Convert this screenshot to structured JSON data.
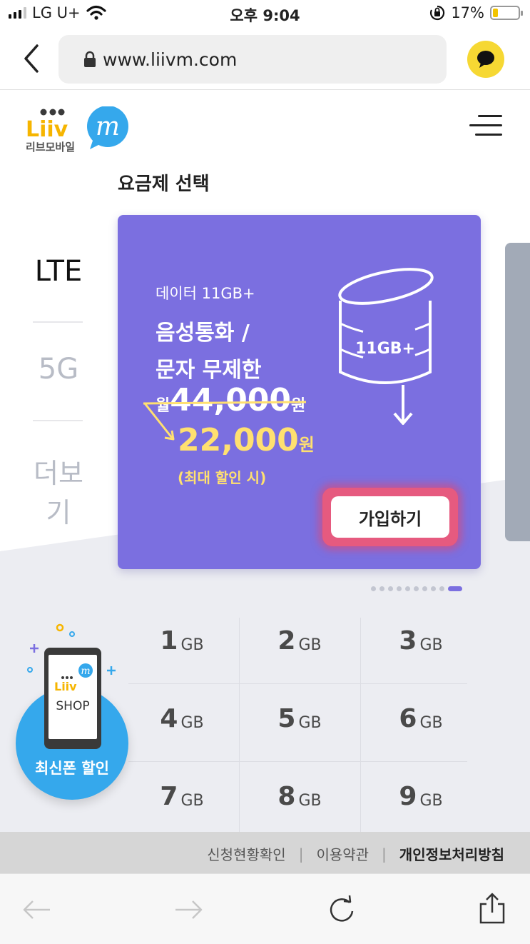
{
  "status_bar": {
    "carrier": "LG U+",
    "time": "오후 9:04",
    "battery": "17%"
  },
  "browser": {
    "url": "www.liivm.com"
  },
  "header": {
    "logo_text": "Liiv",
    "logo_sub": "리브모바일",
    "logo_badge": "m"
  },
  "main": {
    "section_title": "요금제 선택",
    "tabs": [
      {
        "label": "LTE"
      },
      {
        "label": "5G"
      },
      {
        "label": "더보기"
      }
    ],
    "card": {
      "line1": "데이터 11GB+",
      "line2": "음성통화 /",
      "line3": "문자 무제한",
      "old_prefix": "월",
      "old_price": "44,000",
      "old_unit": "원",
      "new_price": "22,000",
      "new_unit": "원",
      "note": "(최대 할인 시)",
      "graphic_label": "11GB+",
      "join_label": "가입하기"
    },
    "carousel": {
      "count": 10,
      "active_index": 9
    },
    "data_options": [
      {
        "value": "1",
        "unit": "GB"
      },
      {
        "value": "2",
        "unit": "GB"
      },
      {
        "value": "3",
        "unit": "GB"
      },
      {
        "value": "4",
        "unit": "GB"
      },
      {
        "value": "5",
        "unit": "GB"
      },
      {
        "value": "6",
        "unit": "GB"
      },
      {
        "value": "7",
        "unit": "GB"
      },
      {
        "value": "8",
        "unit": "GB"
      },
      {
        "value": "9",
        "unit": "GB"
      }
    ],
    "shop": {
      "badge": "m",
      "brand": "Liiv",
      "shop_text": "SHOP",
      "label": "최신폰 할인"
    }
  },
  "footer": {
    "links": [
      "신청현황확인",
      "이용약관",
      "개인정보처리방침"
    ],
    "separator": "|"
  },
  "colors": {
    "card": "#7b6fe0",
    "price": "#ffe070",
    "accent": "#35a8ec",
    "kakao": "#f6d833"
  }
}
